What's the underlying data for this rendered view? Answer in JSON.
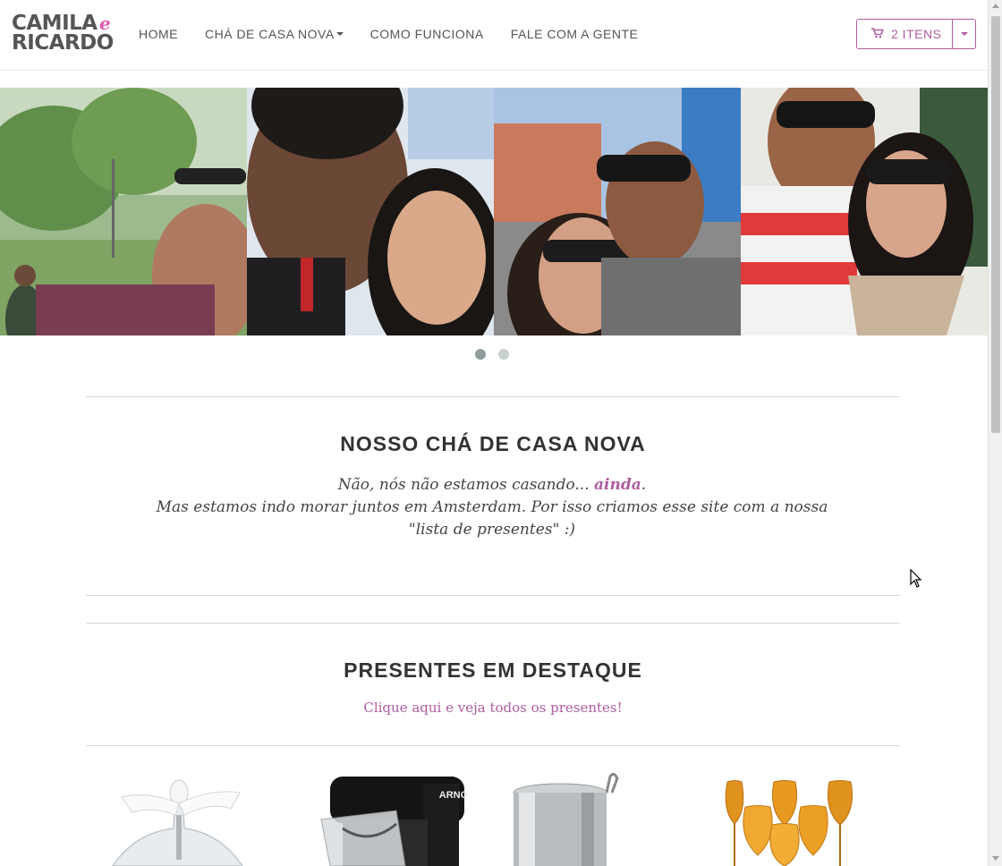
{
  "brand": {
    "line1": "CAMILA",
    "line2": "RICARDO",
    "amp": "e"
  },
  "nav": {
    "home": "HOME",
    "cha": "CHÁ DE CASA NOVA",
    "como": "COMO FUNCIONA",
    "fale": "FALE COM A GENTE"
  },
  "cart": {
    "label": "2 ITENS",
    "icon": "cart-icon"
  },
  "carousel": {
    "slides": 2,
    "active": 1
  },
  "intro": {
    "title": "NOSSO CHÁ DE CASA NOVA",
    "line1_a": "Não, nós não estamos casando... ",
    "line1_em": "ainda",
    "line1_b": ".",
    "line2": "Mas estamos indo morar juntos em Amsterdam. Por isso criamos esse site com a nossa \"lista de presentes\" :)"
  },
  "featured": {
    "title": "PRESENTES EM DESTAQUE",
    "link": "Clique aqui e veja todos os presentes!"
  },
  "products": [
    {
      "name": "glass-bell"
    },
    {
      "name": "arno-mixer",
      "brand_text": "ARNO"
    },
    {
      "name": "steel-trash-can"
    },
    {
      "name": "amber-wine-glasses"
    }
  ],
  "colors": {
    "accent": "#b05ca0",
    "logo_amp": "#e05bb3",
    "text": "#333333"
  }
}
